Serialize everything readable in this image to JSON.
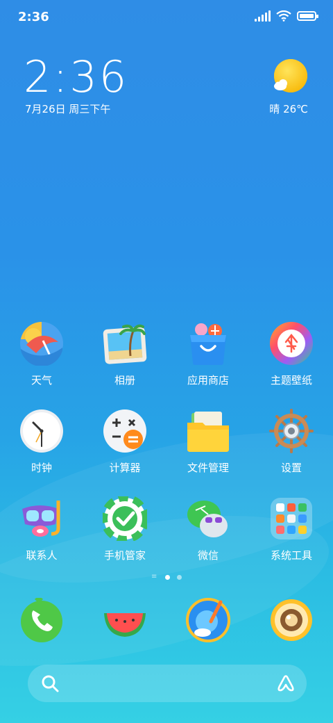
{
  "status_bar": {
    "time": "2:36"
  },
  "widget": {
    "time": "2:36",
    "date": "7月26日 周三下午",
    "weather": "晴 26℃"
  },
  "apps": [
    [
      {
        "label": "天气",
        "icon": "weather-icon"
      },
      {
        "label": "相册",
        "icon": "gallery-icon"
      },
      {
        "label": "应用商店",
        "icon": "app-store-icon"
      },
      {
        "label": "主题壁纸",
        "icon": "themes-icon"
      }
    ],
    [
      {
        "label": "时钟",
        "icon": "clock-icon"
      },
      {
        "label": "计算器",
        "icon": "calculator-icon"
      },
      {
        "label": "文件管理",
        "icon": "file-manager-icon"
      },
      {
        "label": "设置",
        "icon": "settings-icon"
      }
    ],
    [
      {
        "label": "联系人",
        "icon": "contacts-icon"
      },
      {
        "label": "手机管家",
        "icon": "security-icon"
      },
      {
        "label": "微信",
        "icon": "wechat-icon"
      },
      {
        "label": "系统工具",
        "icon": "tools-folder-icon"
      }
    ]
  ],
  "dock": [
    {
      "icon": "phone-icon"
    },
    {
      "icon": "messages-icon"
    },
    {
      "icon": "browser-icon"
    },
    {
      "icon": "camera-icon"
    }
  ],
  "page_indicator": {
    "pages": 2,
    "active": 1
  },
  "search": {
    "left_icon": "search-icon",
    "right_icon": "xiaoai-icon"
  }
}
